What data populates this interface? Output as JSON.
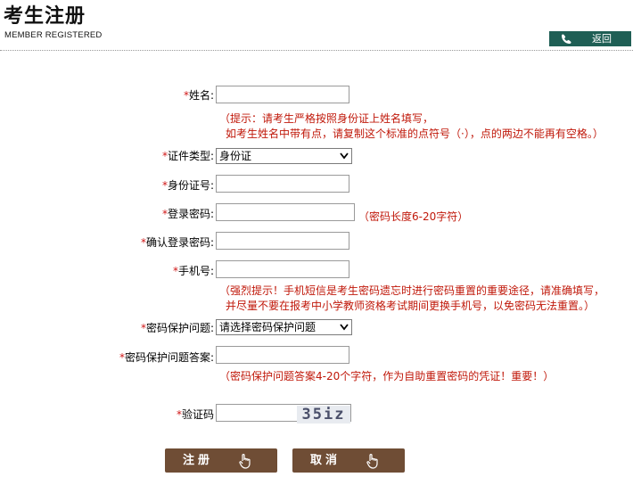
{
  "header": {
    "title": "考生注册",
    "subtitle": "MEMBER REGISTERED",
    "back_label": "返回"
  },
  "form": {
    "required_mark": "*",
    "name": {
      "label": "姓名:",
      "value": ""
    },
    "name_hint": {
      "line1": "（提示：请考生严格按照身份证上姓名填写，",
      "line2": "如考生姓名中带有点，请复制这个标准的点符号（·），点的两边不能再有空格。）"
    },
    "id_type": {
      "label": "证件类型:",
      "selected": "身份证"
    },
    "id_number": {
      "label": "身份证号:",
      "value": ""
    },
    "password": {
      "label": "登录密码:",
      "value": "",
      "hint": "（密码长度6-20字符）"
    },
    "confirm_password": {
      "label": "确认登录密码:",
      "value": ""
    },
    "phone": {
      "label": "手机号:",
      "value": ""
    },
    "phone_hint": {
      "line1": "（强烈提示！手机短信是考生密码遗忘时进行密码重置的重要途径，请准确填写，",
      "line2": "并尽量不要在报考中小学教师资格考试期间更换手机号，以免密码无法重置。）"
    },
    "security_question": {
      "label": "密码保护问题:",
      "selected": "请选择密码保护问题"
    },
    "security_answer": {
      "label": "密码保护问题答案:",
      "value": "",
      "hint": "（密码保护问题答案4-20个字符，作为自助重置密码的凭证！重要！）"
    },
    "captcha": {
      "label": "验证码",
      "value": "",
      "image_text": "35iz"
    }
  },
  "buttons": {
    "register": "注册",
    "cancel": "取消"
  },
  "colors": {
    "accent_teal": "#1f5f55",
    "button_brown": "#6f4d35",
    "hint_red": "#c0180a",
    "required_red": "#d01616"
  },
  "icons": {
    "back": "phone-back-icon",
    "hand": "hand-pointer-icon"
  }
}
